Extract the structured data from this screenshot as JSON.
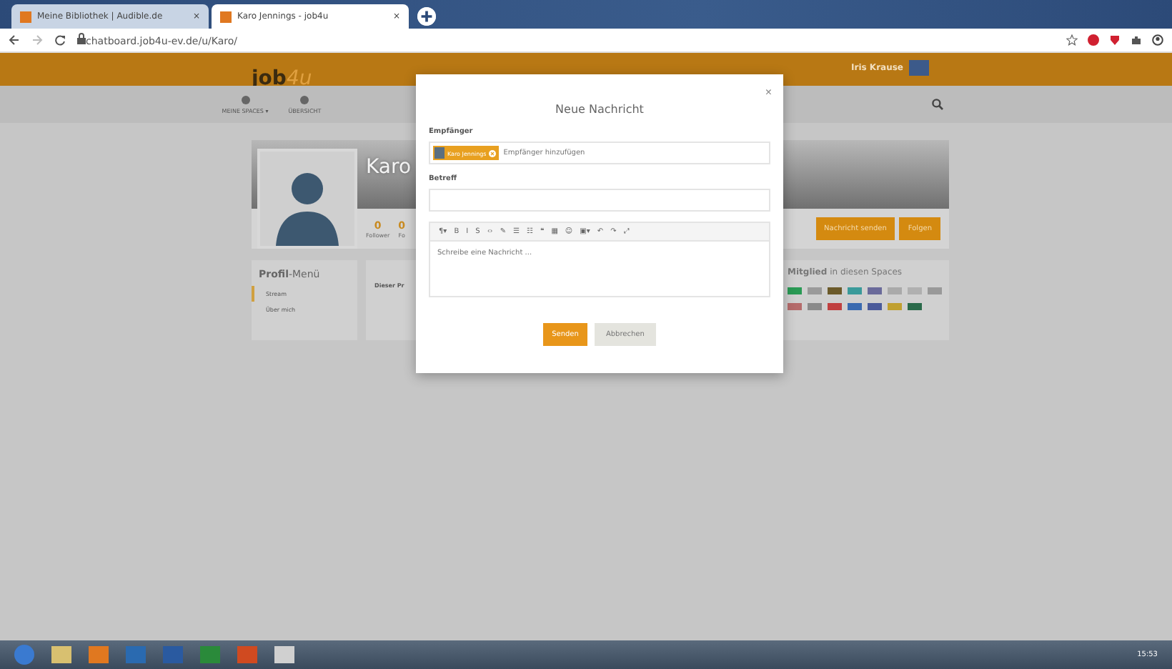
{
  "browser": {
    "tabs": [
      {
        "title": "Meine Bibliothek | Audible.de",
        "close": "×",
        "selected": false
      },
      {
        "title": "Karo Jennings - job4u",
        "close": "×",
        "selected": true
      }
    ],
    "url": "chatboard.job4u-ev.de/u/Karo/"
  },
  "header": {
    "logo_main": "job",
    "logo_accent": "4u",
    "user": "Iris Krause"
  },
  "nav": [
    {
      "label": "MEINE SPACES ▾"
    },
    {
      "label": "ÜBERSICHT"
    }
  ],
  "profile": {
    "name": "Karo",
    "stats": [
      {
        "count": "0",
        "label": "Follower"
      },
      {
        "count": "0",
        "label": "Fo"
      }
    ],
    "tab": "Dieser Pr",
    "menu_title": "**Profil**-Menü",
    "menu": [
      {
        "label": "Stream",
        "selected": true
      },
      {
        "label": "Über mich",
        "selected": false
      }
    ],
    "buttons": [
      "Nachricht senden",
      "Folgen"
    ],
    "spaces_title": "**Mitglied** in diesen Spaces"
  },
  "modal": {
    "title": "Neue Nachricht",
    "close": "×",
    "recipient_label": "Empfänger",
    "recipients": [
      {
        "name": "Karo Jennings"
      }
    ],
    "recipient_placeholder": "Empfänger hinzufügen",
    "subject_label": "Betreff",
    "toolbar": [
      "¶▾",
      "B",
      "I",
      "S",
      "‹›",
      "✎",
      "☰",
      "☷",
      "❝",
      "▦",
      "☺",
      "▣▾",
      "↶",
      "↷",
      "⤢"
    ],
    "message_placeholder": "Schreibe eine Nachricht ...",
    "buttons": [
      "Senden",
      "Abbrechen"
    ]
  },
  "taskbar": {
    "time": "15:53"
  }
}
